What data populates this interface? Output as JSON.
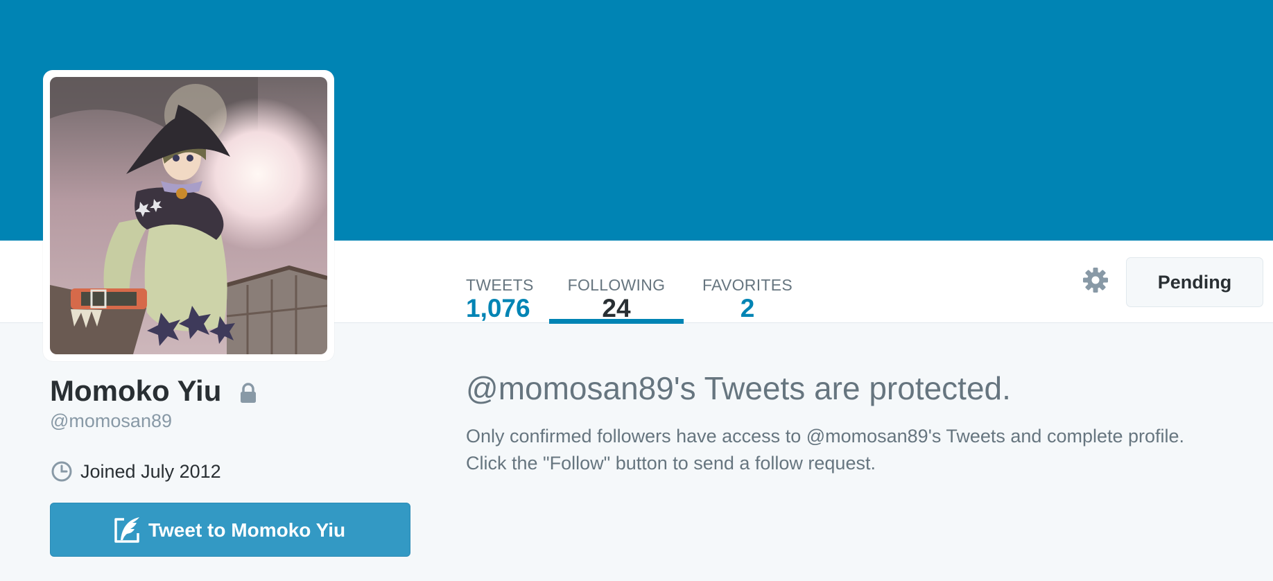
{
  "profile": {
    "name": "Momoko Yiu",
    "screen_name": "@momosan89",
    "joined": "Joined July 2012",
    "protected": true
  },
  "nav": {
    "stats": [
      {
        "label": "TWEETS",
        "value": "1,076",
        "active": false
      },
      {
        "label": "FOLLOWING",
        "value": "24",
        "active": true
      },
      {
        "label": "FAVORITES",
        "value": "2",
        "active": false
      }
    ],
    "settings_icon": "gear-icon",
    "pending_label": "Pending"
  },
  "sidebar": {
    "tweet_to_label": "Tweet to Momoko Yiu",
    "tweet_to_icon": "quill-icon",
    "joined_icon": "clock-icon",
    "lock_icon": "lock-icon"
  },
  "main": {
    "protected_title": "@momosan89's Tweets are protected.",
    "protected_line1": "Only confirmed followers have access to @momosan89's Tweets and complete profile.",
    "protected_line2": "Click the \"Follow\" button to send a follow request."
  },
  "colors": {
    "banner": "#0084b4",
    "accent": "#0084b4",
    "button": "#3399c4",
    "muted_text": "#66757f",
    "background": "#f5f8fa"
  }
}
